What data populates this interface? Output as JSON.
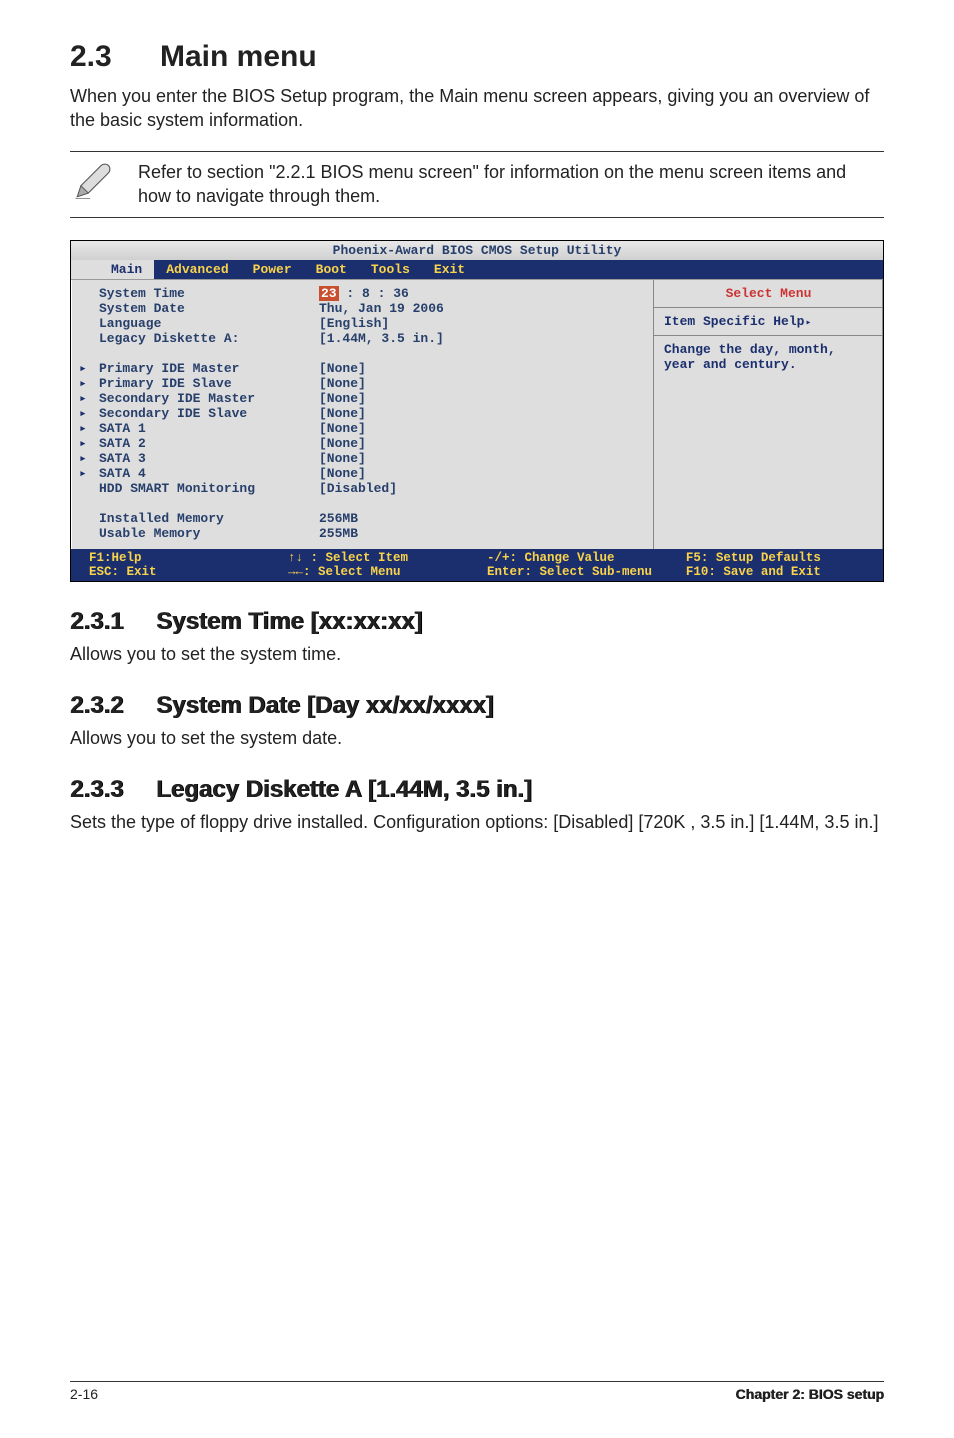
{
  "section": {
    "number": "2.3",
    "title": "Main menu"
  },
  "intro": "When you enter the BIOS Setup program, the Main menu screen appears, giving you an overview of the basic system information.",
  "note": "Refer to section \"2.2.1 BIOS menu screen\" for information on the menu screen items and how to navigate through them.",
  "bios": {
    "title": "Phoenix-Award BIOS CMOS Setup Utility",
    "menus": [
      "Main",
      "Advanced",
      "Power",
      "Boot",
      "Tools",
      "Exit"
    ],
    "active_menu": "Main",
    "rows_top": [
      {
        "label": "System Time",
        "value_prefix": "",
        "highlight": "23",
        "value_suffix": " : 8 : 36"
      },
      {
        "label": "System Date",
        "value": "Thu, Jan 19 2006"
      },
      {
        "label": "Language",
        "value": "[English]"
      },
      {
        "label": "Legacy Diskette A:",
        "value": "[1.44M, 3.5 in.]"
      }
    ],
    "rows_sub": [
      {
        "label": "Primary IDE Master",
        "value": "[None]"
      },
      {
        "label": "Primary IDE Slave",
        "value": "[None]"
      },
      {
        "label": "Secondary IDE Master",
        "value": "[None]"
      },
      {
        "label": "Secondary IDE Slave",
        "value": "[None]"
      },
      {
        "label": "SATA 1",
        "value": "[None]"
      },
      {
        "label": "SATA 2",
        "value": "[None]"
      },
      {
        "label": "SATA 3",
        "value": "[None]"
      },
      {
        "label": "SATA 4",
        "value": "[None]"
      }
    ],
    "rows_mid": [
      {
        "label": "HDD SMART Monitoring",
        "value": "[Disabled]"
      }
    ],
    "rows_bottom": [
      {
        "label": "Installed Memory",
        "value": "256MB"
      },
      {
        "label": "Usable Memory",
        "value": "255MB"
      }
    ],
    "right": {
      "select": "Select Menu",
      "help_label": "Item Specific Help",
      "help_text": "Change the day, month, year and century."
    },
    "footer": {
      "col1_l1": "F1:Help",
      "col1_l2": "ESC: Exit",
      "col2_l1": "↑↓ : Select Item",
      "col2_l2": "→←: Select Menu",
      "col3_l1": "-/+: Change Value",
      "col3_l2": "Enter: Select Sub-menu",
      "col4_l1": "F5: Setup Defaults",
      "col4_l2": "F10: Save and Exit"
    }
  },
  "subs": [
    {
      "num": "2.3.1",
      "title": "System Time [xx:xx:xx]",
      "body": "Allows you to set the system time."
    },
    {
      "num": "2.3.2",
      "title": "System Date [Day xx/xx/xxxx]",
      "body": "Allows you to set the system date."
    },
    {
      "num": "2.3.3",
      "title": "Legacy Diskette A [1.44M, 3.5 in.]",
      "body": "Sets the type of floppy drive installed. Configuration options: [Disabled] [720K , 3.5 in.] [1.44M, 3.5 in.]"
    }
  ],
  "footer": {
    "left": "2-16",
    "right": "Chapter 2: BIOS setup"
  }
}
